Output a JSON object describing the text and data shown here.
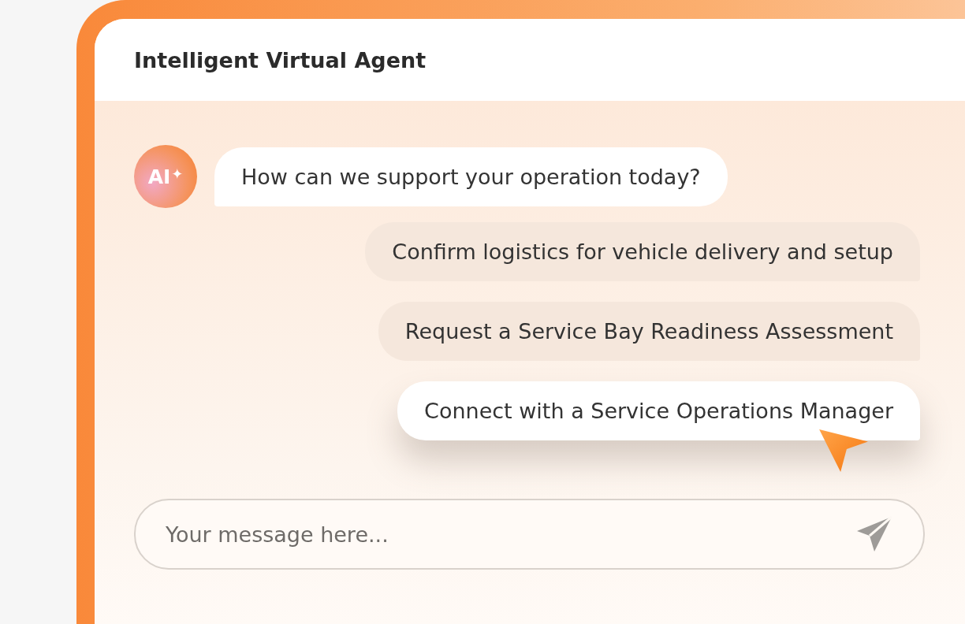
{
  "window": {
    "title": "Intelligent Virtual Agent"
  },
  "agent": {
    "avatar_label": "AI",
    "avatar_mark": "✦"
  },
  "messages": [
    {
      "kind": "agent",
      "text": "How can we support your operation today?"
    }
  ],
  "suggestions": [
    {
      "label": "Confirm logistics for vehicle delivery and setup",
      "selected": false
    },
    {
      "label": "Request a Service Bay Readiness Assessment",
      "selected": false
    },
    {
      "label": "Connect with a Service Operations Manager",
      "selected": true
    }
  ],
  "composer": {
    "placeholder": "Your message here..."
  }
}
